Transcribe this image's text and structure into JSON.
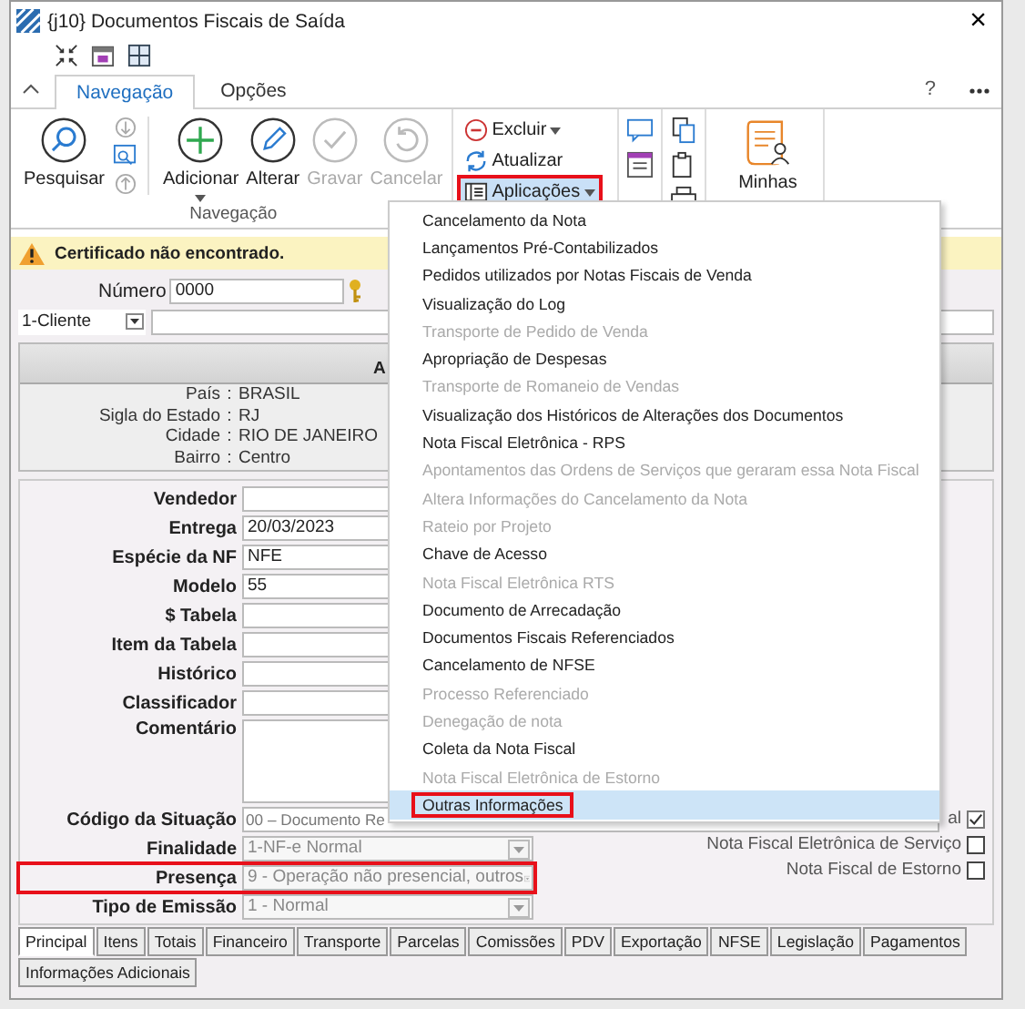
{
  "window": {
    "title": "{j10} Documentos Fiscais de Saída",
    "close": "×"
  },
  "ribbon": {
    "tabs": [
      {
        "label": "Navegação",
        "selected": true
      },
      {
        "label": "Opções",
        "selected": false
      }
    ],
    "help": "?",
    "large_buttons": [
      {
        "label": "Pesquisar",
        "disabled": false,
        "dropdown": false
      },
      {
        "label": "Adicionar",
        "disabled": false,
        "dropdown": true
      },
      {
        "label": "Alterar",
        "disabled": false,
        "dropdown": false
      },
      {
        "label": "Gravar",
        "disabled": true,
        "dropdown": false
      },
      {
        "label": "Cancelar",
        "disabled": true,
        "dropdown": false
      }
    ],
    "group_label": "Navegação",
    "small_buttons": [
      {
        "label": "Excluir",
        "dropdown": true,
        "highlighted": false
      },
      {
        "label": "Atualizar",
        "dropdown": false,
        "highlighted": false
      },
      {
        "label": "Aplicações",
        "dropdown": true,
        "highlighted": true
      }
    ],
    "my_apps_label": "Minhas"
  },
  "menu": [
    {
      "label": "Cancelamento da Nota",
      "disabled": false,
      "selected": false,
      "highlighted": false
    },
    {
      "label": "Lançamentos Pré-Contabilizados",
      "disabled": false,
      "selected": false,
      "highlighted": false
    },
    {
      "label": "Pedidos utilizados por Notas Fiscais de Venda",
      "disabled": false,
      "selected": false,
      "highlighted": false
    },
    {
      "label": "Visualização do Log",
      "disabled": false,
      "selected": false,
      "highlighted": false
    },
    {
      "label": "Transporte de Pedido de Venda",
      "disabled": true,
      "selected": false,
      "highlighted": false
    },
    {
      "label": "Apropriação de Despesas",
      "disabled": false,
      "selected": false,
      "highlighted": false
    },
    {
      "label": "Transporte de Romaneio de Vendas",
      "disabled": true,
      "selected": false,
      "highlighted": false
    },
    {
      "label": "Visualização dos Históricos de Alterações dos Documentos",
      "disabled": false,
      "selected": false,
      "highlighted": false
    },
    {
      "label": "Nota Fiscal Eletrônica - RPS",
      "disabled": false,
      "selected": false,
      "highlighted": false
    },
    {
      "label": "Apontamentos das Ordens de Serviços que geraram essa Nota Fiscal",
      "disabled": true,
      "selected": false,
      "highlighted": false
    },
    {
      "label": "Altera Informações do Cancelamento da Nota",
      "disabled": true,
      "selected": false,
      "highlighted": false
    },
    {
      "label": "Rateio por Projeto",
      "disabled": true,
      "selected": false,
      "highlighted": false
    },
    {
      "label": "Chave de Acesso",
      "disabled": false,
      "selected": false,
      "highlighted": false
    },
    {
      "label": "Nota Fiscal Eletrônica RTS",
      "disabled": true,
      "selected": false,
      "highlighted": false
    },
    {
      "label": "Documento de Arrecadação",
      "disabled": false,
      "selected": false,
      "highlighted": false
    },
    {
      "label": "Documentos Fiscais Referenciados",
      "disabled": false,
      "selected": false,
      "highlighted": false
    },
    {
      "label": "Cancelamento de NFSE",
      "disabled": false,
      "selected": false,
      "highlighted": false
    },
    {
      "label": "Processo Referenciado",
      "disabled": true,
      "selected": false,
      "highlighted": false
    },
    {
      "label": "Denegação de nota",
      "disabled": true,
      "selected": false,
      "highlighted": false
    },
    {
      "label": "Coleta da Nota Fiscal",
      "disabled": false,
      "selected": false,
      "highlighted": false
    },
    {
      "label": "Nota Fiscal Eletrônica de Estorno",
      "disabled": true,
      "selected": false,
      "highlighted": false
    },
    {
      "label": "Outras Informações",
      "disabled": false,
      "selected": true,
      "highlighted": true
    }
  ],
  "alert": "Certificado não encontrado.",
  "numero": {
    "label": "Número",
    "value": "0000"
  },
  "party": {
    "value": "1-Cliente"
  },
  "address": {
    "header": "A",
    "rows": [
      {
        "label": "País",
        "sep": ":",
        "value": "BRASIL"
      },
      {
        "label": "Sigla do Estado",
        "sep": ":",
        "value": "RJ"
      },
      {
        "label": "Cidade",
        "sep": ":",
        "value": "RIO DE JANEIRO"
      },
      {
        "label": "Bairro",
        "sep": ":",
        "value": "Centro"
      }
    ]
  },
  "fields": [
    {
      "kind": "text",
      "label": "Vendedor"
    },
    {
      "kind": "text",
      "label": "Entrega",
      "value": "20/03/2023"
    },
    {
      "kind": "text",
      "label": "Espécie da NF",
      "value": "NFE"
    },
    {
      "kind": "text",
      "label": "Modelo",
      "value": "55"
    },
    {
      "kind": "text",
      "label": "$ Tabela"
    },
    {
      "kind": "text",
      "label": "Item da Tabela"
    },
    {
      "kind": "text",
      "label": "Histórico"
    },
    {
      "kind": "text",
      "label": "Classificador"
    },
    {
      "kind": "textarea",
      "label": "Comentário"
    },
    {
      "kind": "text",
      "label": "Código da Situação",
      "value": "00 – Documento Re",
      "disabled": true
    },
    {
      "kind": "select",
      "label": "Finalidade",
      "value": "1-NF-e Normal",
      "disabled": true,
      "highlighted": false
    },
    {
      "kind": "select",
      "label": "Presença",
      "value": "9 - Operação não presencial, outros",
      "disabled": true,
      "highlighted": true
    },
    {
      "kind": "select",
      "label": "Tipo de Emissão",
      "value": "1 - Normal",
      "disabled": true,
      "highlighted": false
    }
  ],
  "checkboxes": [
    {
      "label": "al",
      "checked": true
    },
    {
      "label": "Nota Fiscal Eletrônica de Serviço",
      "checked": false
    },
    {
      "label": "Nota Fiscal de Estorno",
      "checked": false
    }
  ],
  "bottom_tabs": [
    [
      {
        "label": "Principal",
        "selected": true
      },
      {
        "label": "Itens",
        "selected": false
      },
      {
        "label": "Totais",
        "selected": false
      },
      {
        "label": "Financeiro",
        "selected": false
      },
      {
        "label": "Transporte",
        "selected": false
      },
      {
        "label": "Parcelas",
        "selected": false
      },
      {
        "label": "Comissões",
        "selected": false
      },
      {
        "label": "PDV",
        "selected": false
      },
      {
        "label": "Exportação",
        "selected": false
      },
      {
        "label": "NFSE",
        "selected": false
      },
      {
        "label": "Legislação",
        "selected": false
      },
      {
        "label": "Pagamentos",
        "selected": false
      }
    ],
    [
      {
        "label": "Informações Adicionais",
        "selected": false
      }
    ]
  ]
}
